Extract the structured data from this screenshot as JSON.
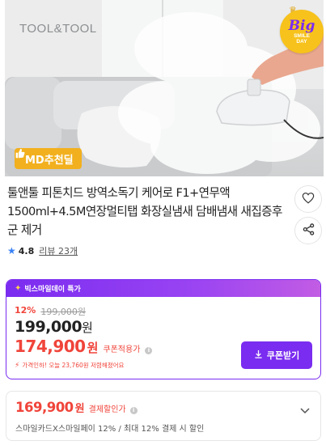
{
  "hero": {
    "brand": "TOOL&TOOL",
    "md_badge": "MD추천딜",
    "big_badge": {
      "big": "Big",
      "line1": "SMILE",
      "line2": "DAY"
    }
  },
  "product": {
    "title": "툴앤툴 피톤치드 방역소독기 케어로 F1+연무액 1500ml+4.5M연장멀티탭 화장실냄새 담배냄새 새집증후군 제거",
    "rating": "4.8",
    "reviews_label": "리뷰 23개"
  },
  "promo": {
    "header": "빅스마일데이 특가",
    "discount_rate": "12%",
    "original_price": "199,000원",
    "sale_price": "199,000",
    "sale_unit": "원",
    "coupon_price": "174,900",
    "coupon_unit": "원",
    "coupon_label": "쿠폰적용가",
    "price_drop_note": "가격인하! 오늘 23,760원 저렴해졌어요",
    "coupon_button": "쿠폰받기"
  },
  "card_discount": {
    "price": "169,900",
    "unit": "원",
    "label": "결제할인가",
    "description": "스마일카드X스마일페이 12% / 최대 12% 결제 시 할인"
  },
  "colors": {
    "purple": "#7a2cf0",
    "red": "#f0443a",
    "badge_yellow": "#f2b01e"
  },
  "icons": [
    "heart-icon",
    "share-icon",
    "star-icon",
    "info-icon",
    "download-icon",
    "chevron-down-icon",
    "thumbs-up-icon"
  ]
}
